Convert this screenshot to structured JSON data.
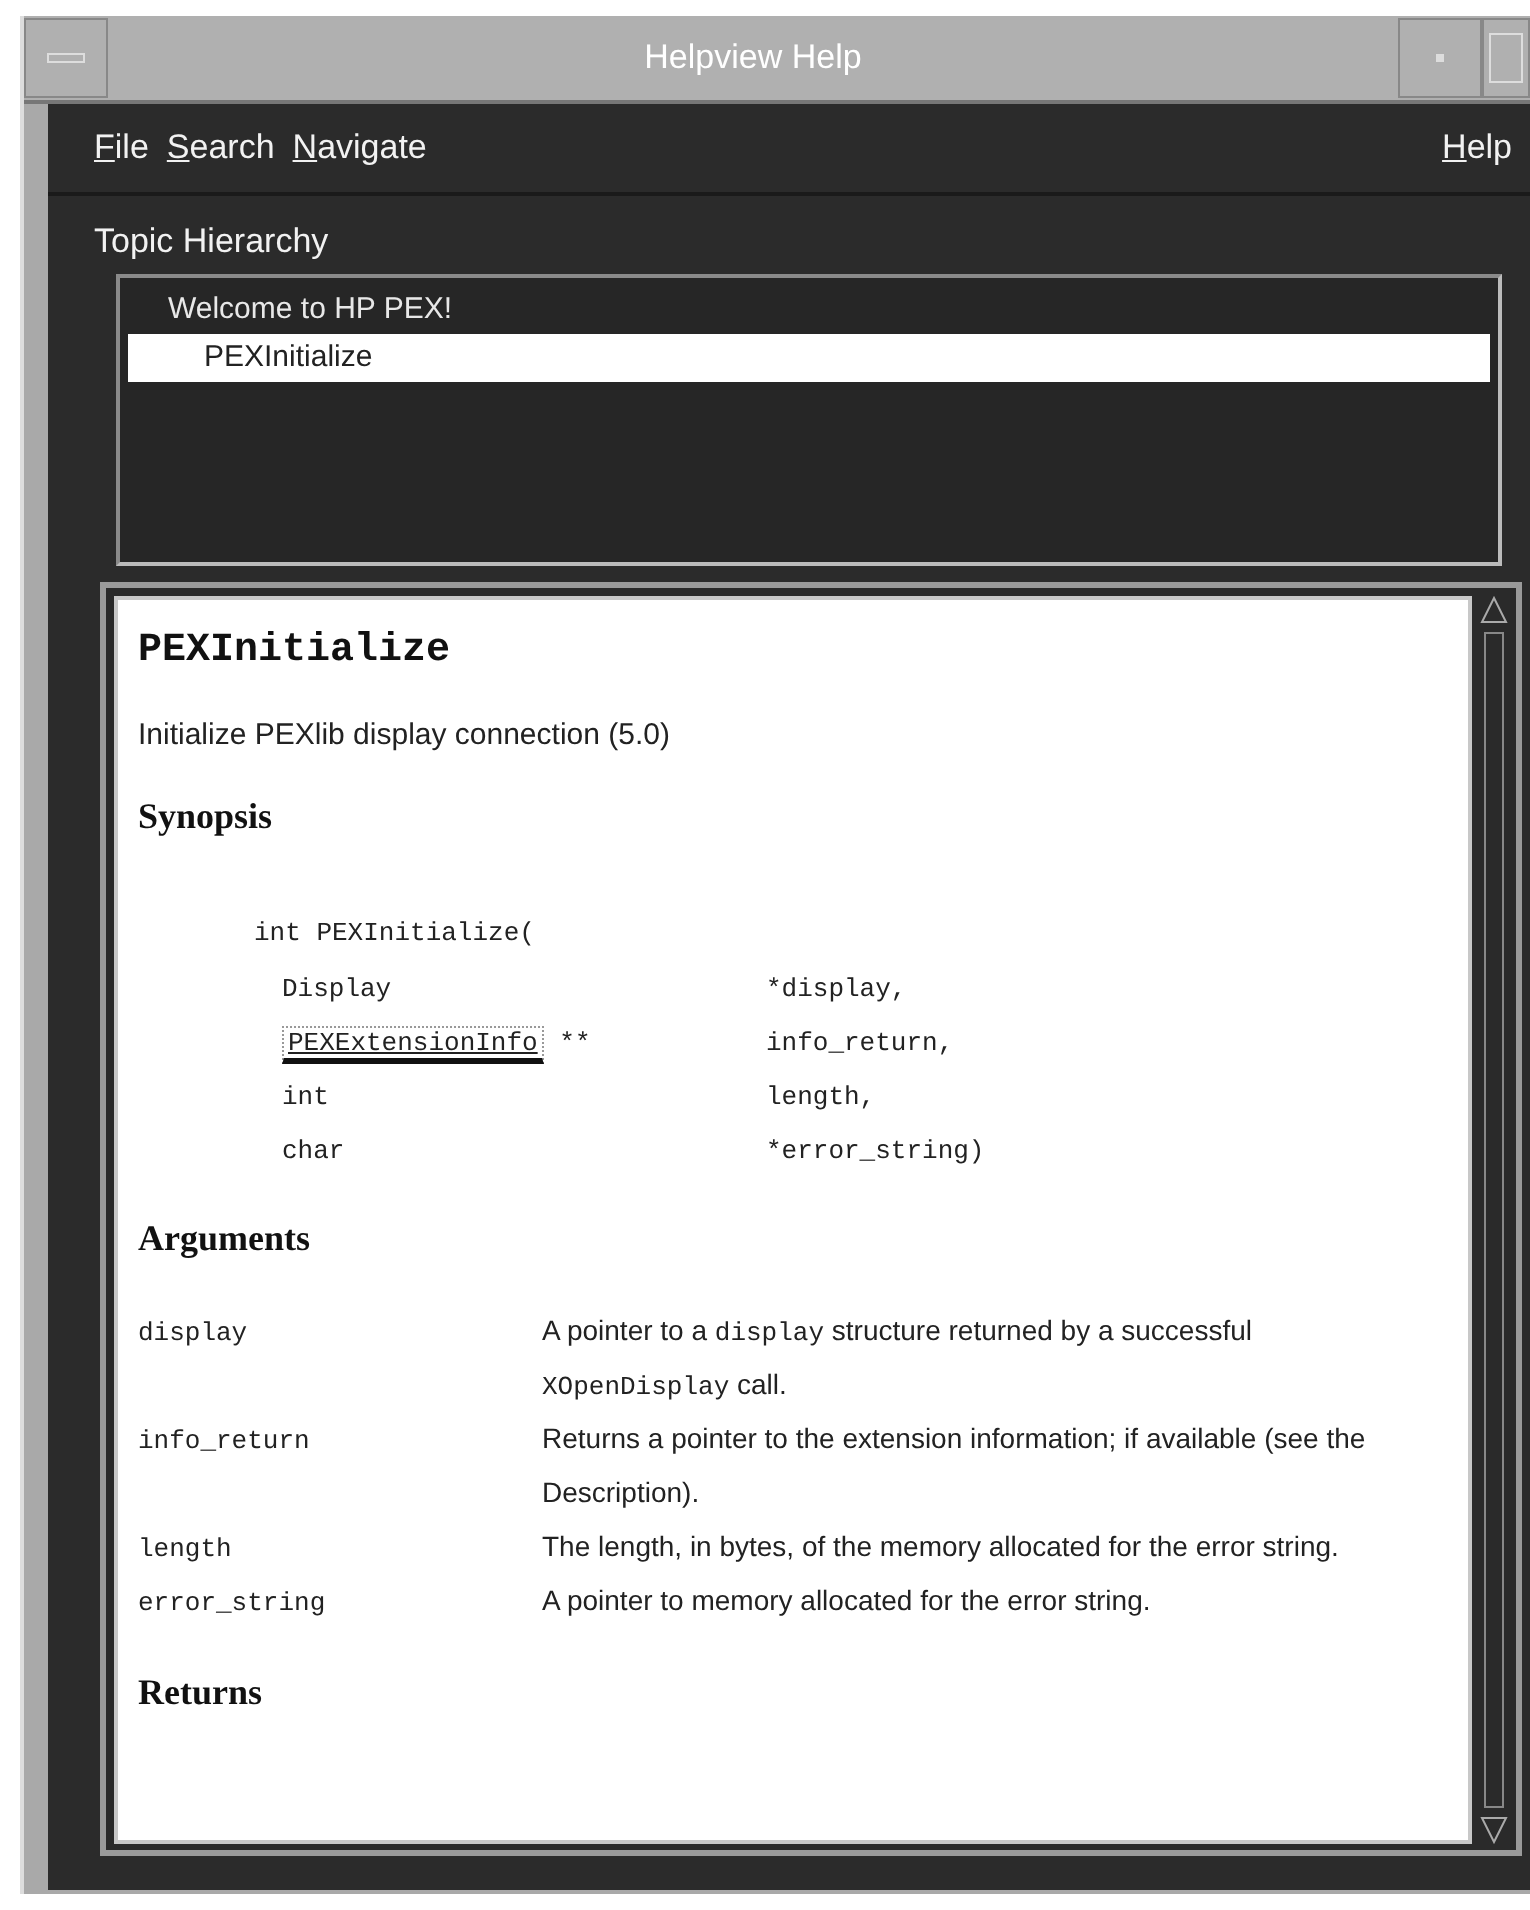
{
  "window": {
    "title": "Helpview Help"
  },
  "menu_bar": {
    "left": [
      {
        "label": "File"
      },
      {
        "label": "Search"
      },
      {
        "label": "Navigate"
      }
    ],
    "right": [
      {
        "label": "Help"
      }
    ]
  },
  "topic_hierarchy": {
    "label": "Topic Hierarchy",
    "items": [
      {
        "label": "Welcome to HP PEX!",
        "selected": false,
        "children": [
          {
            "label": "PEXInitialize",
            "selected": true
          }
        ]
      }
    ]
  },
  "content": {
    "title": "PEXInitialize",
    "summary": "Initialize PEXlib display connection (5.0)",
    "synopsis": {
      "heading": "Synopsis",
      "call": "int PEXInitialize(",
      "params": [
        {
          "type": "Display",
          "kind": "text",
          "name": "*display,"
        },
        {
          "type": "PEXExtensionInfo",
          "kind": "link",
          "suffix": "**",
          "name": "info_return,"
        },
        {
          "type": "int",
          "kind": "text",
          "name": "length,"
        },
        {
          "type": "char",
          "kind": "text",
          "name": "*error_string)"
        }
      ]
    },
    "arguments": {
      "heading": "Arguments",
      "rows": [
        {
          "name": "display",
          "description": [
            {
              "kind": "text",
              "text": "A pointer to a "
            },
            {
              "kind": "code",
              "text": "display"
            },
            {
              "kind": "text",
              "text": " structure returned by a successful "
            },
            {
              "kind": "code",
              "text": "XOpenDisplay"
            },
            {
              "kind": "text",
              "text": " call."
            }
          ]
        },
        {
          "name": "info_return",
          "description": [
            {
              "kind": "text",
              "text": "Returns a pointer to the extension information; if available (see the Description)."
            }
          ]
        },
        {
          "name": "length",
          "description": [
            {
              "kind": "text",
              "text": "The length, in bytes, of the memory allocated for the error string."
            }
          ]
        },
        {
          "name": "error_string",
          "description": [
            {
              "kind": "text",
              "text": "A pointer to memory allocated for the error string."
            }
          ]
        }
      ]
    },
    "next_heading": "Returns"
  }
}
